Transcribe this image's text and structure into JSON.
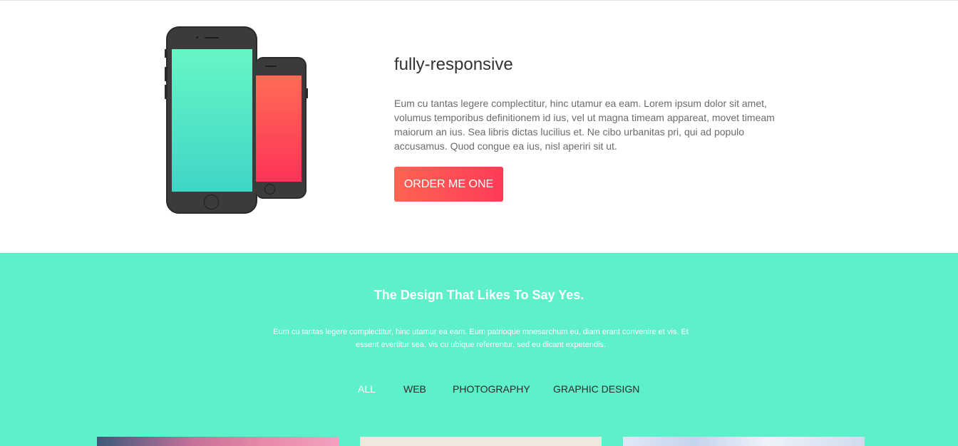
{
  "hero": {
    "title": "fully-responsive",
    "text": "Eum cu tantas legere complectitur, hinc utamur ea eam. Lorem ipsum dolor sit amet, volumus temporibus definitionem id ius, vel ut magna timeam appareat, movet timeam maiorum an ius. Sea libris dictas lucilius et. Ne cibo urbanitas pri, qui ad populo accusamus. Quod congue ea ius, nisl aperiri sit ut.",
    "button_label": "ORDER ME ONE",
    "colors": {
      "button_gradient_start": "#fd6453",
      "button_gradient_end": "#fe3b58",
      "phone_screen_green": "#5ef0c6",
      "phone_screen_red": "#fe4a57"
    }
  },
  "portfolio": {
    "title": "The Design That Likes To Say Yes.",
    "text": "Eum cu tantas legere complectitur, hinc utamur ea eam. Eum patrioque mnesarchum eu, diam erant convenire et vis. Et essent evertitur sea, vis cu ubique referrentur, sed eu dicant expetendis.",
    "filters": [
      {
        "label": "ALL",
        "active": true
      },
      {
        "label": "WEB",
        "active": false
      },
      {
        "label": "PHOTOGRAPHY",
        "active": false
      },
      {
        "label": "GRAPHIC DESIGN",
        "active": false
      }
    ],
    "background_color": "#5eefcb"
  }
}
